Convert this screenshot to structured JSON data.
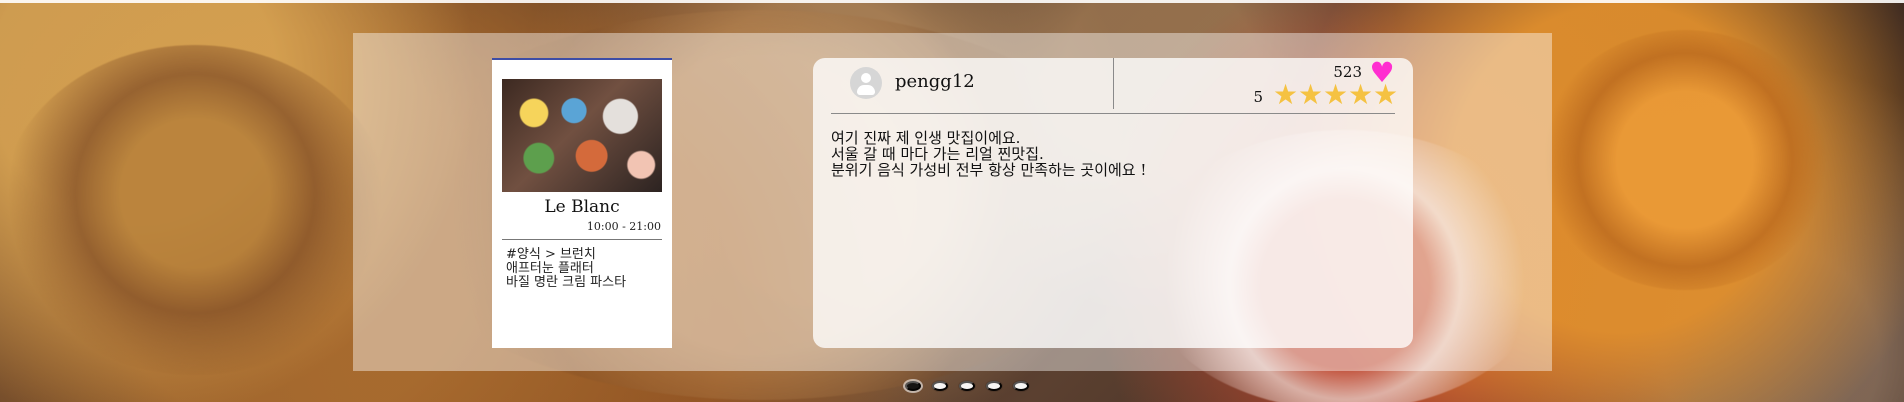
{
  "restaurant": {
    "name": "Le Blanc",
    "hours": "10:00 - 21:00",
    "tags": [
      "#양식 > 브런치",
      "애프터눈 플래터",
      "바질 명란 크림 파스타"
    ]
  },
  "review": {
    "username": "pengg12",
    "likes": "523",
    "rating": "5",
    "text": [
      "여기 진짜 제 인생 맛집이에요.",
      "서울 갈 때 마다 가는 리얼 찐맛집.",
      "분위기 음식 가성비 전부 항상 만족하는 곳이에요 !"
    ]
  },
  "icons": {
    "avatar": "user-avatar-icon",
    "heart": "heart-icon",
    "star": "star-icon"
  },
  "colors": {
    "heart": "#ff2ed0",
    "star": "#f5c242",
    "active_dot": "#111111",
    "inactive_dot": "#ffffff"
  },
  "carousel": {
    "dots": 5,
    "active_index": 0
  }
}
